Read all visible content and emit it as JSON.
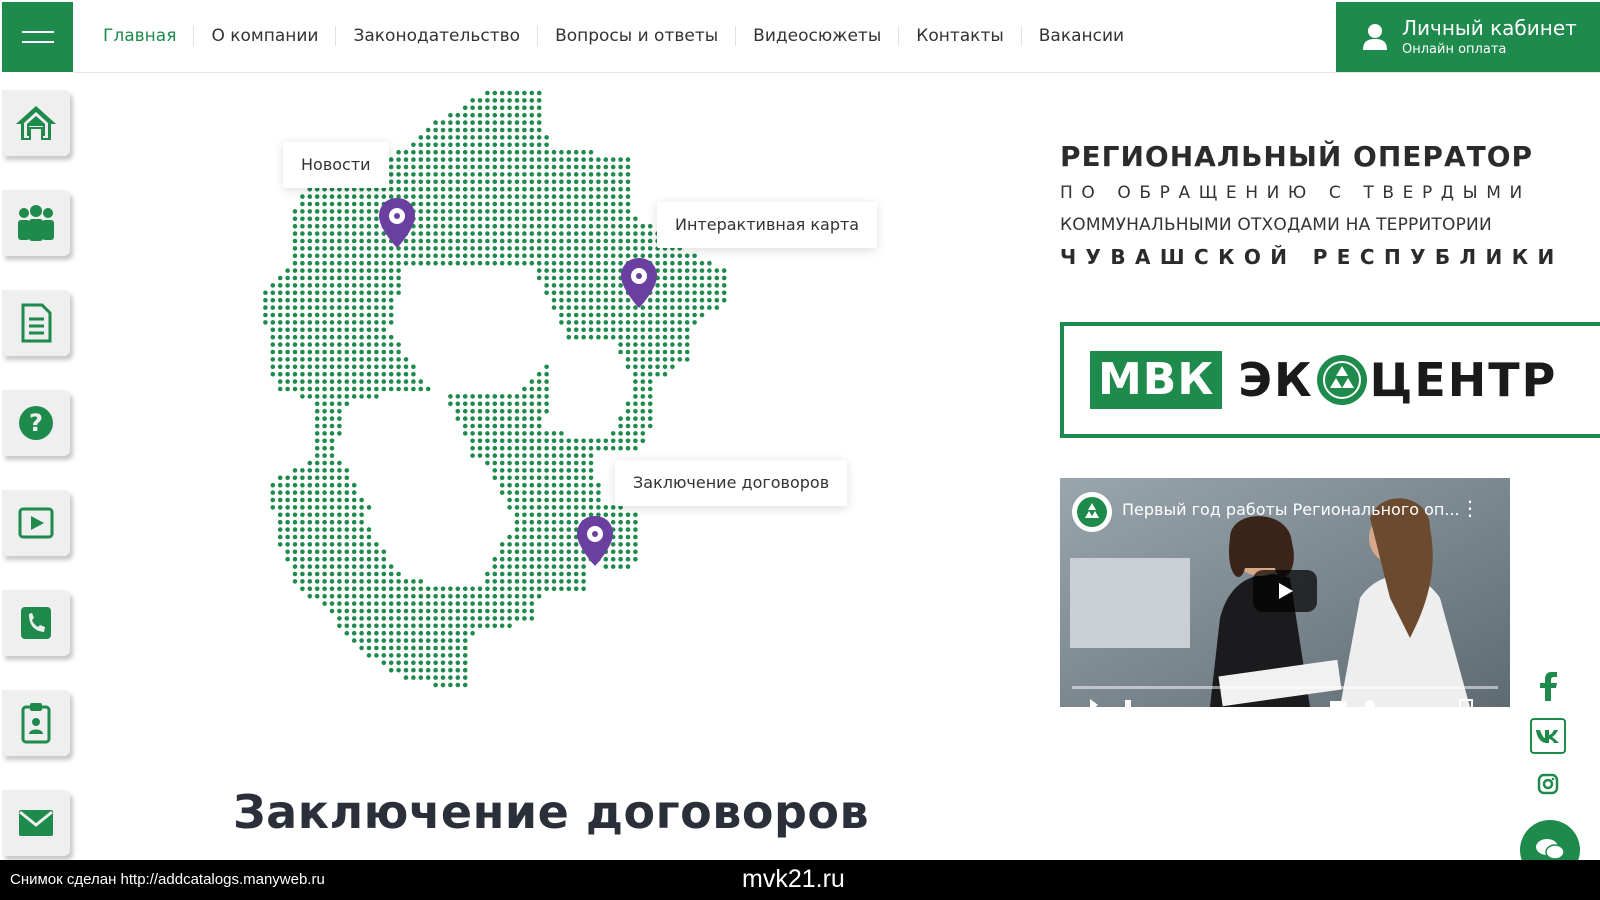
{
  "nav": {
    "items": [
      {
        "label": "Главная"
      },
      {
        "label": "О компании"
      },
      {
        "label": "Законодательство"
      },
      {
        "label": "Вопросы и ответы"
      },
      {
        "label": "Видеосюжеты"
      },
      {
        "label": "Контакты"
      },
      {
        "label": "Вакансии"
      }
    ],
    "active_index": 0
  },
  "cabinet": {
    "title": "Личный кабинет",
    "subtitle": "Онлайн оплата"
  },
  "sidebar": {
    "icons": [
      "home-icon",
      "people-icon",
      "document-icon",
      "question-icon",
      "video-icon",
      "phone-icon",
      "clipboard-icon",
      "mail-icon"
    ]
  },
  "map": {
    "labels": {
      "news": "Новости",
      "interactive_map": "Интерактивная карта",
      "contracts": "Заключение договоров"
    }
  },
  "headline": {
    "line1": "РЕГИОНАЛЬНЫЙ ОПЕРАТОР",
    "line2": "ПО ОБРАЩЕНИЮ С ТВЕРДЫМИ",
    "line3": "КОММУНАЛЬНЫМИ ОТХОДАМИ НА ТЕРРИТОРИИ",
    "line4": "ЧУВАШСКОЙ РЕСПУБЛИКИ"
  },
  "logo": {
    "part1": "МВК",
    "part2a": "ЭК",
    "part2b": "ЦЕНТР"
  },
  "video": {
    "title": "Первый год работы Регионального оп..."
  },
  "section": {
    "title": "Заключение договоров"
  },
  "footer": {
    "left": "Снимок сделан http://addcatalogs.manyweb.ru",
    "center": "mvk21.ru"
  },
  "colors": {
    "brand_green": "#1e8a4c",
    "pin_purple": "#6a3fa0"
  }
}
